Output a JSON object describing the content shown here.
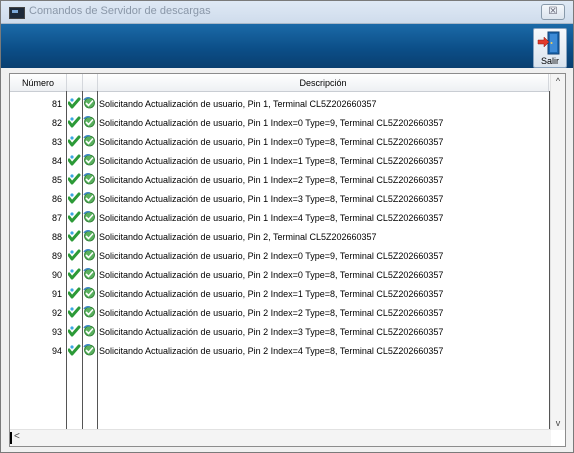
{
  "window": {
    "title": "Comandos de Servidor de descargas",
    "close_label": "☒"
  },
  "toolbar": {
    "exit_label": "Salir"
  },
  "list": {
    "headers": {
      "number": "Número",
      "description": "Descripción"
    },
    "rows": [
      {
        "num": "81",
        "desc": "Solicitando Actualización de usuario, Pin 1, Terminal CL5Z202660357"
      },
      {
        "num": "82",
        "desc": "Solicitando Actualización de usuario, Pin 1 Index=0 Type=9, Terminal CL5Z202660357"
      },
      {
        "num": "83",
        "desc": "Solicitando Actualización de usuario, Pin 1 Index=0 Type=8, Terminal CL5Z202660357"
      },
      {
        "num": "84",
        "desc": "Solicitando Actualización de usuario, Pin 1 Index=1 Type=8, Terminal CL5Z202660357"
      },
      {
        "num": "85",
        "desc": "Solicitando Actualización de usuario, Pin 1 Index=2 Type=8, Terminal CL5Z202660357"
      },
      {
        "num": "86",
        "desc": "Solicitando Actualización de usuario, Pin 1 Index=3 Type=8, Terminal CL5Z202660357"
      },
      {
        "num": "87",
        "desc": "Solicitando Actualización de usuario, Pin 1 Index=4 Type=8, Terminal CL5Z202660357"
      },
      {
        "num": "88",
        "desc": "Solicitando Actualización de usuario, Pin 2, Terminal CL5Z202660357"
      },
      {
        "num": "89",
        "desc": "Solicitando Actualización de usuario, Pin 2 Index=0 Type=9, Terminal CL5Z202660357"
      },
      {
        "num": "90",
        "desc": "Solicitando Actualización de usuario, Pin 2 Index=0 Type=8, Terminal CL5Z202660357"
      },
      {
        "num": "91",
        "desc": "Solicitando Actualización de usuario, Pin 2 Index=1 Type=8, Terminal CL5Z202660357"
      },
      {
        "num": "92",
        "desc": "Solicitando Actualización de usuario, Pin 2 Index=2 Type=8, Terminal CL5Z202660357"
      },
      {
        "num": "93",
        "desc": "Solicitando Actualización de usuario, Pin 2 Index=3 Type=8, Terminal CL5Z202660357"
      },
      {
        "num": "94",
        "desc": "Solicitando Actualización de usuario, Pin 2 Index=4 Type=8, Terminal CL5Z202660357"
      }
    ]
  },
  "icons": {
    "status": "check-icon",
    "sync": "sync-icon"
  }
}
